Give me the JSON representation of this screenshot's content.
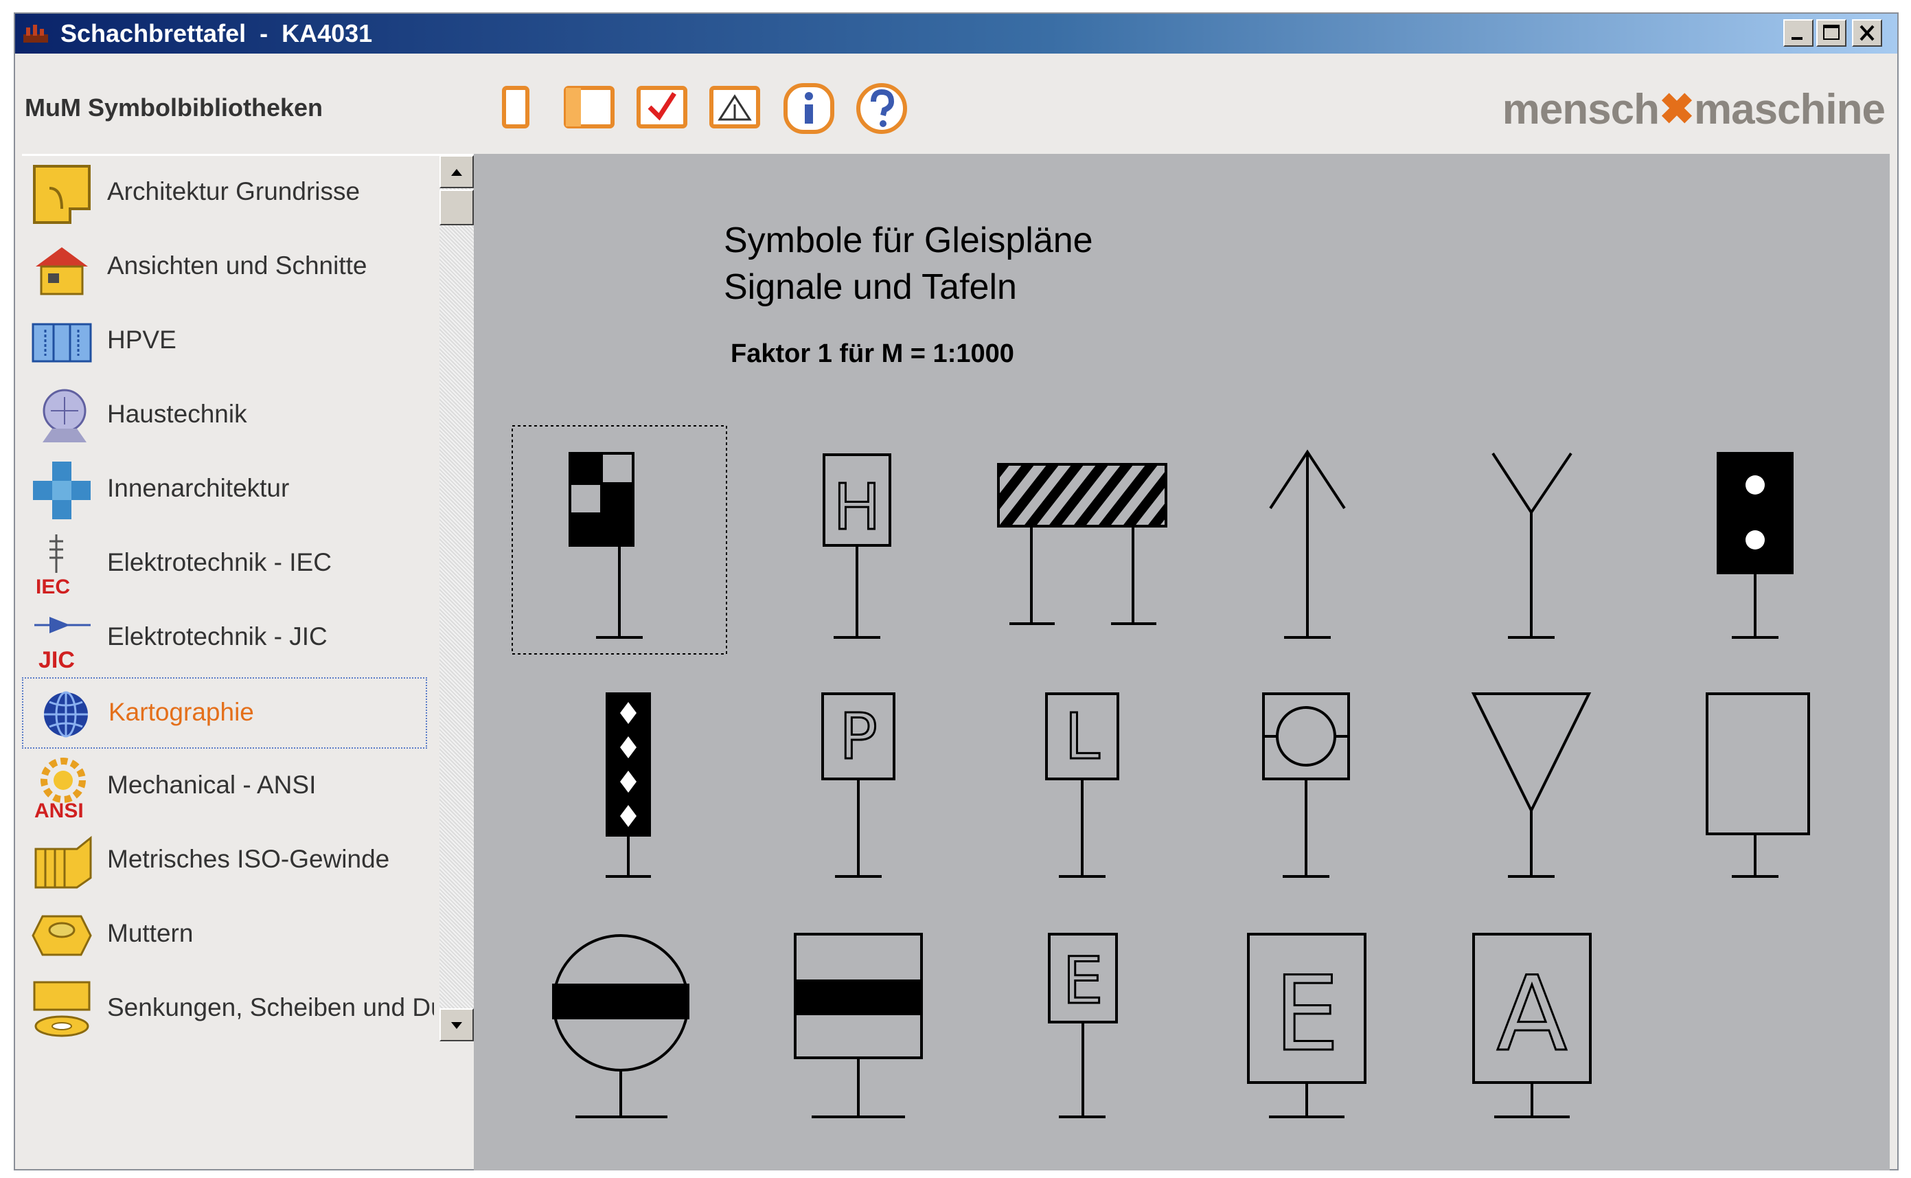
{
  "window": {
    "title": "Schachbrettafel  -  KA4031"
  },
  "header": {
    "library_title": "MuM Symbolbibliotheken",
    "brand_left": "mensch",
    "brand_right": "maschine",
    "toolbar": [
      {
        "icon": "blank-page-icon"
      },
      {
        "icon": "open-book-icon"
      },
      {
        "icon": "checkmark-icon"
      },
      {
        "icon": "insert-symbol-icon"
      },
      {
        "icon": "info-icon"
      },
      {
        "icon": "help-icon"
      }
    ]
  },
  "sidebar": {
    "items": [
      {
        "label": "Architektur Grundrisse",
        "icon": "floorplan-icon"
      },
      {
        "label": "Ansichten und Schnitte",
        "icon": "house-icon"
      },
      {
        "label": "HPVE",
        "icon": "hpve-icon"
      },
      {
        "label": "Haustechnik",
        "icon": "monitor-icon"
      },
      {
        "label": "Innenarchitektur",
        "icon": "furniture-icon"
      },
      {
        "label": "Elektrotechnik - IEC",
        "icon": "iec-icon",
        "badge": "IEC"
      },
      {
        "label": "Elektrotechnik - JIC",
        "icon": "jic-icon",
        "badge": "JIC"
      },
      {
        "label": "Kartographie",
        "icon": "globe-icon",
        "selected": true
      },
      {
        "label": "Mechanical - ANSI",
        "icon": "gear-icon",
        "badge": "ANSI"
      },
      {
        "label": "Metrisches ISO-Gewinde",
        "icon": "thread-icon"
      },
      {
        "label": "Muttern",
        "icon": "nut-icon"
      },
      {
        "label": "Senkungen, Scheiben und Du",
        "icon": "washer-icon"
      }
    ]
  },
  "content": {
    "title_line1": "Symbole  für  Gleispläne",
    "title_line2": "Signale und Tafeln",
    "scale_note": "Faktor 1 für M = 1:1000",
    "symbol_letters": {
      "h": "H",
      "p": "P",
      "l": "L",
      "e_small": "E",
      "e_large": "E",
      "a": "A"
    }
  },
  "colors": {
    "accent": "#e46f1a",
    "canvas": "#b4b5b8",
    "window_bg": "#eceae8"
  }
}
